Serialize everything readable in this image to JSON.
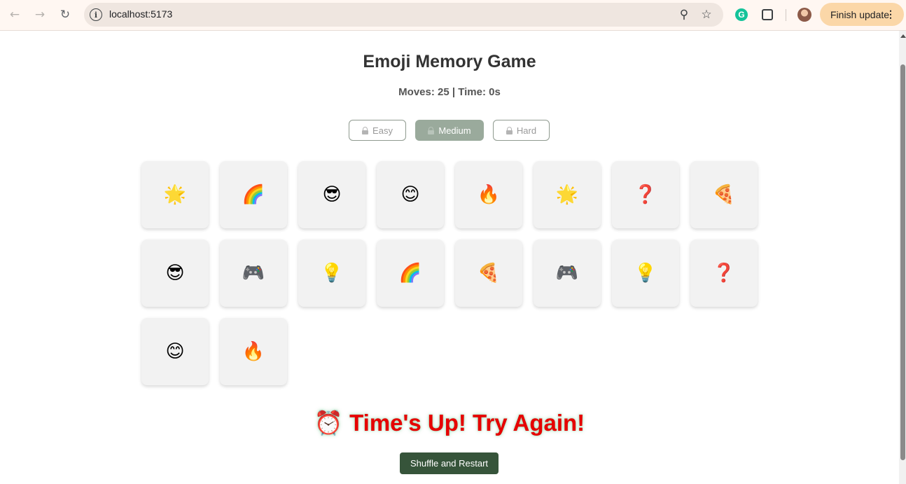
{
  "browser": {
    "url": "localhost:5173",
    "icons": {
      "back": "arrow-left-icon",
      "forward": "arrow-right-icon",
      "reload": "reload-icon",
      "site_info": "info-icon",
      "zoom": "zoom-icon",
      "bookmark": "star-icon",
      "grammarly": "grammarly-icon",
      "extensions": "puzzle-icon",
      "profile": "avatar",
      "menu": "kebab-menu-icon"
    },
    "finish_update_label": "Finish update",
    "grammarly_letter": "G",
    "info_letter": "i",
    "back_glyph": "←",
    "forward_glyph": "→",
    "reload_glyph": "↻",
    "zoom_glyph": "⚲",
    "star_glyph": "☆",
    "menu_glyph": "⋮"
  },
  "game": {
    "title": "Emoji Memory Game",
    "status": "Moves: 25 | Time: 0s",
    "difficulties": [
      {
        "label": "Easy",
        "locked": true,
        "active": false
      },
      {
        "label": "Medium",
        "locked": true,
        "active": true
      },
      {
        "label": "Hard",
        "locked": true,
        "active": false
      }
    ],
    "cards": [
      "🌟",
      "🌈",
      "😎",
      "😊",
      "🔥",
      "🌟",
      "❓",
      "🍕",
      "😎",
      "🎮",
      "💡",
      "🌈",
      "🍕",
      "🎮",
      "💡",
      "❓",
      "😊",
      "🔥"
    ],
    "message": "⏰ Time's Up! Try Again!",
    "restart_label": "Shuffle and Restart"
  },
  "colors": {
    "active_difficulty": "#9aaa9c",
    "restart_button": "#36543a",
    "message": "#e60000",
    "card_bg": "#f2f2f2"
  }
}
